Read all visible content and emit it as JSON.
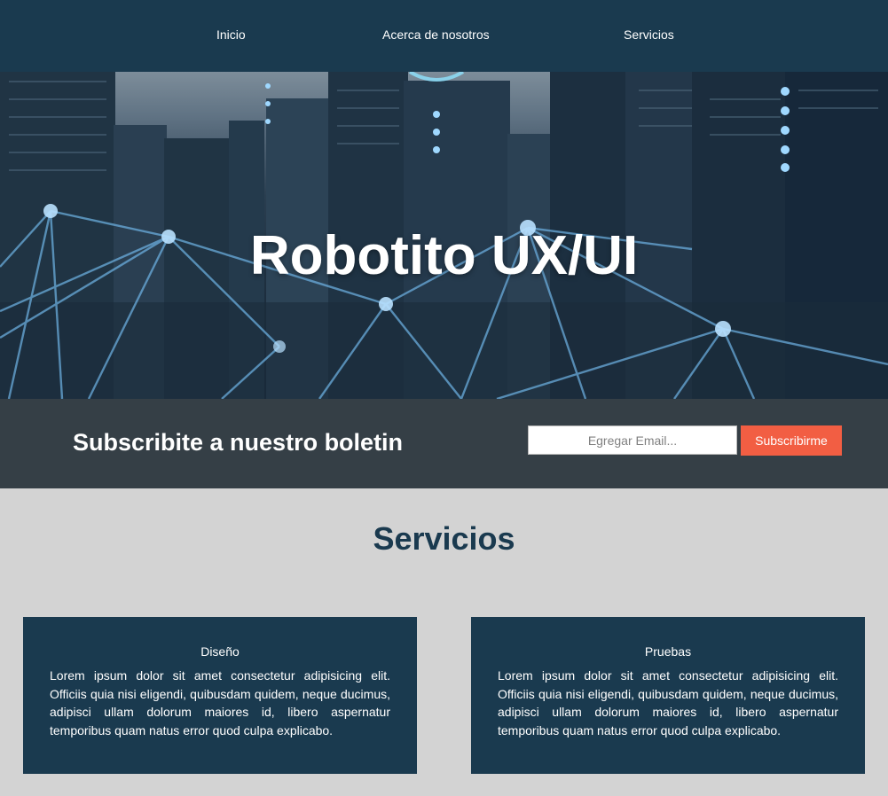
{
  "nav": {
    "items": [
      {
        "label": "Inicio"
      },
      {
        "label": "Acerca de nosotros"
      },
      {
        "label": "Servicios"
      }
    ]
  },
  "hero": {
    "title": "Robotito UX/UI"
  },
  "newsletter": {
    "title": "Subscribite a nuestro boletin",
    "email_placeholder": "Egregar Email...",
    "button_label": "Subscribirme"
  },
  "services": {
    "title": "Servicios",
    "cards": [
      {
        "title": "Diseño",
        "text": "Lorem ipsum dolor sit amet consectetur adipisicing elit. Officiis quia nisi eligendi, quibusdam quidem, neque ducimus, adipisci ullam dolorum maiores id, libero aspernatur temporibus quam natus error quod culpa explicabo."
      },
      {
        "title": "Pruebas",
        "text": "Lorem ipsum dolor sit amet consectetur adipisicing elit. Officiis quia nisi eligendi, quibusdam quidem, neque ducimus, adipisci ullam dolorum maiores id, libero aspernatur temporibus quam natus error quod culpa explicabo."
      }
    ]
  },
  "colors": {
    "nav_bg": "#1a3a4f",
    "newsletter_bg": "#353f46",
    "page_bg": "#d3d3d3",
    "accent": "#f25e43",
    "card_bg": "#1a3a4f"
  }
}
